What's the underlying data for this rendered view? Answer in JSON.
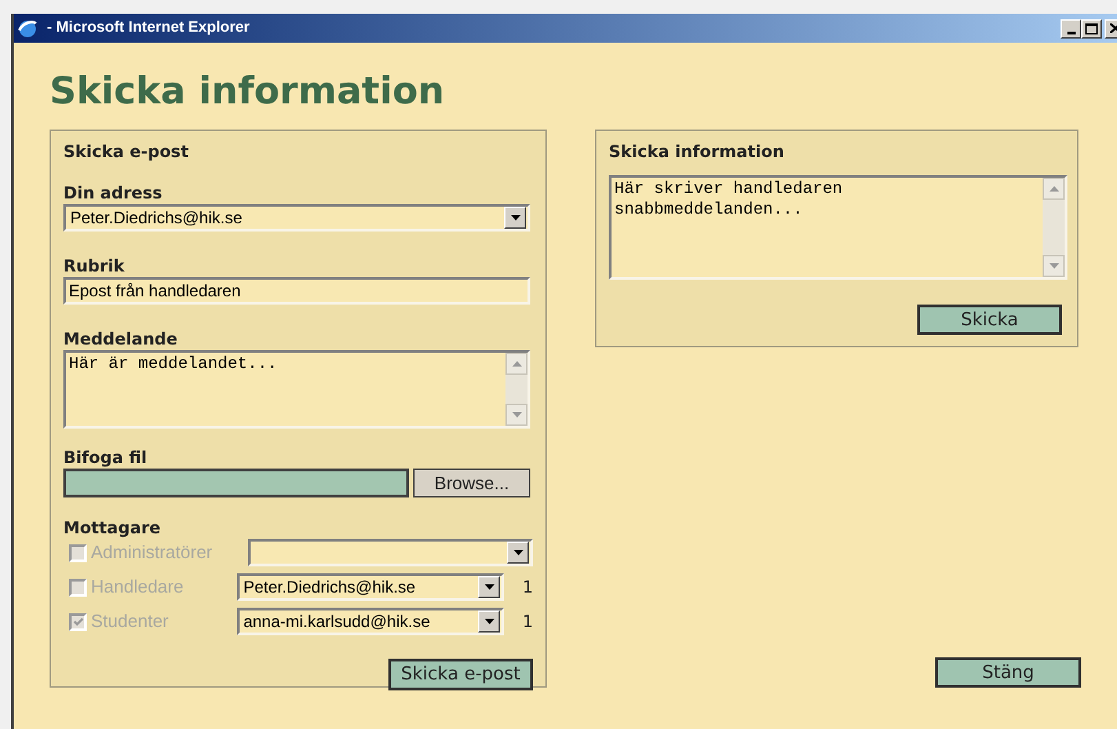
{
  "window": {
    "title": "- Microsoft Internet Explorer"
  },
  "heading": "Skicka information",
  "email_panel": {
    "title": "Skicka e-post",
    "address_label": "Din adress",
    "address_value": "Peter.Diedrichs@hik.se",
    "subject_label": "Rubrik",
    "subject_value": "Epost från handledaren",
    "message_label": "Meddelande",
    "message_value": "Här är meddelandet...",
    "attachment_label": "Bifoga fil",
    "browse_button": "Browse...",
    "recipients_label": "Mottagare",
    "recipients": [
      {
        "label": "Administratörer",
        "checked": false,
        "disabled": true
      },
      {
        "label": "Handledare",
        "checked": false,
        "disabled": true,
        "value": "Peter.Diedrichs@hik.se",
        "count": "1"
      },
      {
        "label": "Studenter",
        "checked": true,
        "disabled": true,
        "value": "anna-mi.karlsudd@hik.se",
        "count": "1"
      }
    ],
    "send_button": "Skicka e-post"
  },
  "info_panel": {
    "title": "Skicka information",
    "message_value": "Här skriver handledaren\nsnabbmeddelanden...",
    "send_button": "Skicka"
  },
  "close_button": "Stäng"
}
